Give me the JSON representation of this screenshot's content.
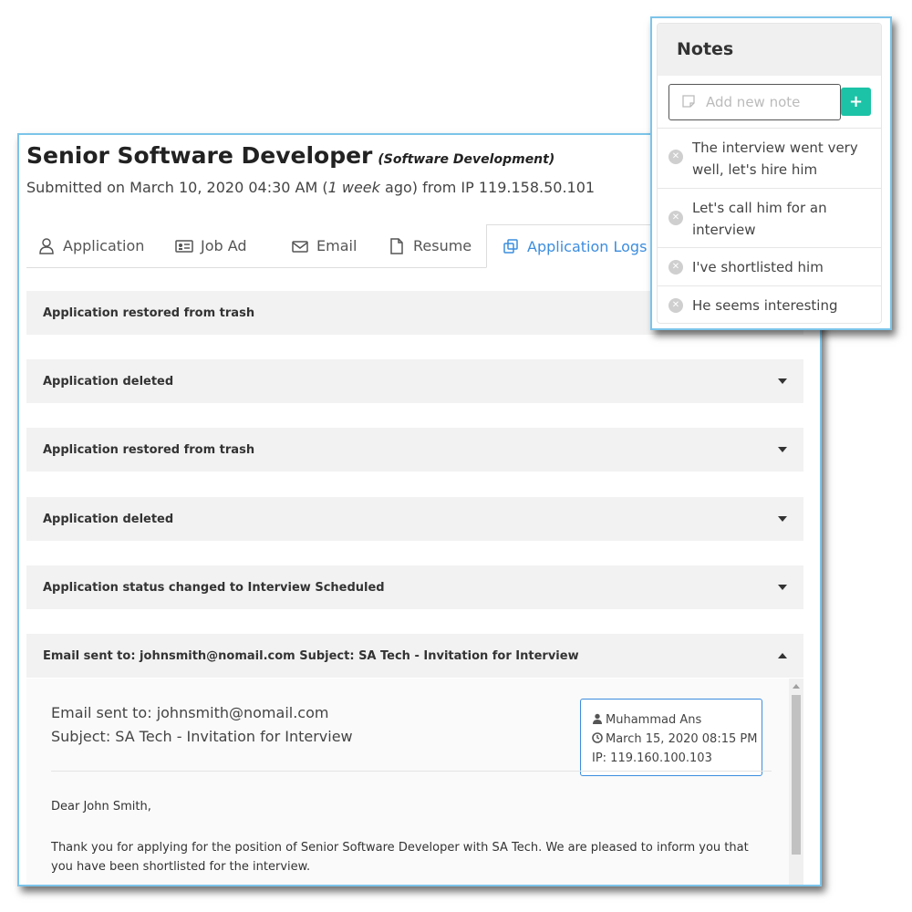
{
  "header": {
    "title": "Senior Software Developer",
    "department": "(Software Development)",
    "submitted_prefix": "Submitted on March 10, 2020 04:30 AM (",
    "submitted_relative": "1 week",
    "submitted_suffix": " ago) from IP 119.158.50.101"
  },
  "tabs": [
    {
      "label": "Application",
      "icon": "user-icon"
    },
    {
      "label": "Job Ad",
      "icon": "id-card-icon"
    },
    {
      "label": "Email",
      "icon": "envelope-icon"
    },
    {
      "label": "Resume",
      "icon": "file-icon"
    },
    {
      "label": "Application Logs",
      "icon": "copy-icon",
      "active": true
    }
  ],
  "logs": [
    {
      "label": "Application restored from trash"
    },
    {
      "label": "Application deleted"
    },
    {
      "label": "Application restored from trash"
    },
    {
      "label": "Application deleted"
    },
    {
      "label": "Application status changed to Interview Scheduled"
    },
    {
      "label": "Email sent to: johnsmith@nomail.com Subject: SA Tech - Invitation for Interview",
      "expanded": true
    }
  ],
  "email": {
    "to": "Email sent to: johnsmith@nomail.com",
    "subject": "Subject: SA Tech - Invitation for Interview",
    "greeting": "Dear John Smith,",
    "body": "Thank you for applying for the position of Senior Software Developer with SA Tech. We are pleased to inform you that you have been shortlisted for the interview.",
    "meta": {
      "author": "Muhammad Ans",
      "date": "March 15, 2020 08:15 PM",
      "ip": "IP: 119.160.100.103"
    }
  },
  "notes": {
    "title": "Notes",
    "placeholder": "Add new note",
    "add_label": "+",
    "items": [
      "The interview went very well, let's hire him",
      "Let's call him for an interview",
      "I've shortlisted him",
      "He seems interesting"
    ]
  },
  "colors": {
    "accent": "#3c8dde",
    "add_button": "#1cc3a6",
    "card_border": "#7cc4ea",
    "log_row_bg": "#f2f2f2"
  }
}
